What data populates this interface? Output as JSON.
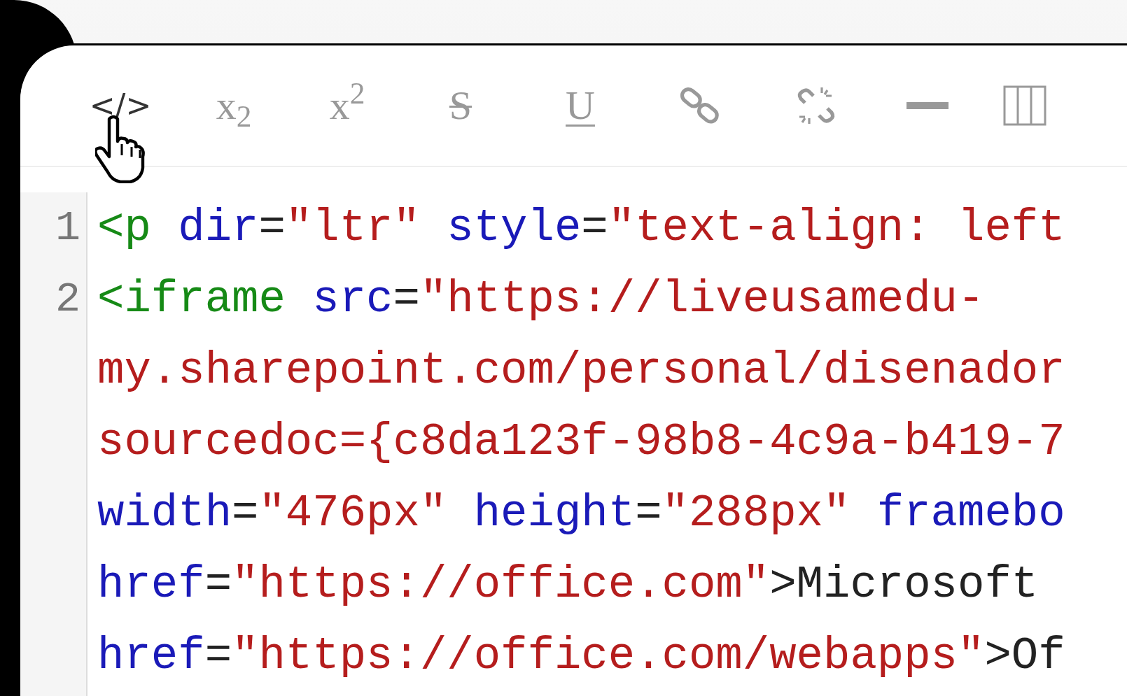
{
  "toolbar": [
    {
      "kind": "text",
      "label": "</>",
      "selected": true
    },
    {
      "kind": "text",
      "label": "x$_{2}$",
      "selected": false
    },
    {
      "kind": "text",
      "label": "x$^{2}$",
      "selected": false
    },
    {
      "kind": "strike",
      "label": "S",
      "selected": false
    },
    {
      "kind": "underline",
      "label": "U",
      "selected": false
    },
    {
      "kind": "link",
      "selected": false
    },
    {
      "kind": "unlink",
      "selected": false
    },
    {
      "kind": "rule",
      "selected": false
    },
    {
      "kind": "columns",
      "selected": false
    }
  ],
  "code_lines": [
    {
      "number": "1",
      "tokens": [
        {
          "kind": "tag",
          "text": "<p"
        },
        {
          "kind": "attr",
          "text": " dir"
        },
        {
          "kind": "punct",
          "text": "="
        },
        {
          "kind": "string",
          "text": "\"ltr\""
        },
        {
          "kind": "attr",
          "text": " style"
        },
        {
          "kind": "punct",
          "text": "="
        },
        {
          "kind": "string",
          "text": "\"text-align: left"
        }
      ]
    },
    {
      "number": "2",
      "tokens": [
        {
          "kind": "tag",
          "text": "<iframe"
        },
        {
          "kind": "attr",
          "text": " src"
        },
        {
          "kind": "punct",
          "text": "="
        },
        {
          "kind": "string",
          "text": "\"https://liveusamedu-"
        }
      ]
    },
    {
      "tokens": [
        {
          "kind": "string",
          "text": "my.sharepoint.com/personal/disenador"
        }
      ]
    },
    {
      "tokens": [
        {
          "kind": "string",
          "text": "sourcedoc={c8da123f-98b8-4c9a-b419-7"
        }
      ]
    },
    {
      "tokens": [
        {
          "kind": "attr",
          "text": "width"
        },
        {
          "kind": "punct",
          "text": "="
        },
        {
          "kind": "string",
          "text": "\"476px\""
        },
        {
          "kind": "attr",
          "text": " height"
        },
        {
          "kind": "punct",
          "text": "="
        },
        {
          "kind": "string",
          "text": "\"288px\""
        },
        {
          "kind": "attr",
          "text": " framebo"
        }
      ]
    },
    {
      "tokens": [
        {
          "kind": "attr",
          "text": "href"
        },
        {
          "kind": "punct",
          "text": "="
        },
        {
          "kind": "string",
          "text": "\"https://office.com\""
        },
        {
          "kind": "punct",
          "text": ">Microsoft"
        }
      ]
    },
    {
      "tokens": [
        {
          "kind": "attr",
          "text": "href"
        },
        {
          "kind": "punct",
          "text": "="
        },
        {
          "kind": "string",
          "text": "\"https://office.com/webapps\""
        },
        {
          "kind": "punct",
          "text": ">Of"
        }
      ]
    }
  ]
}
